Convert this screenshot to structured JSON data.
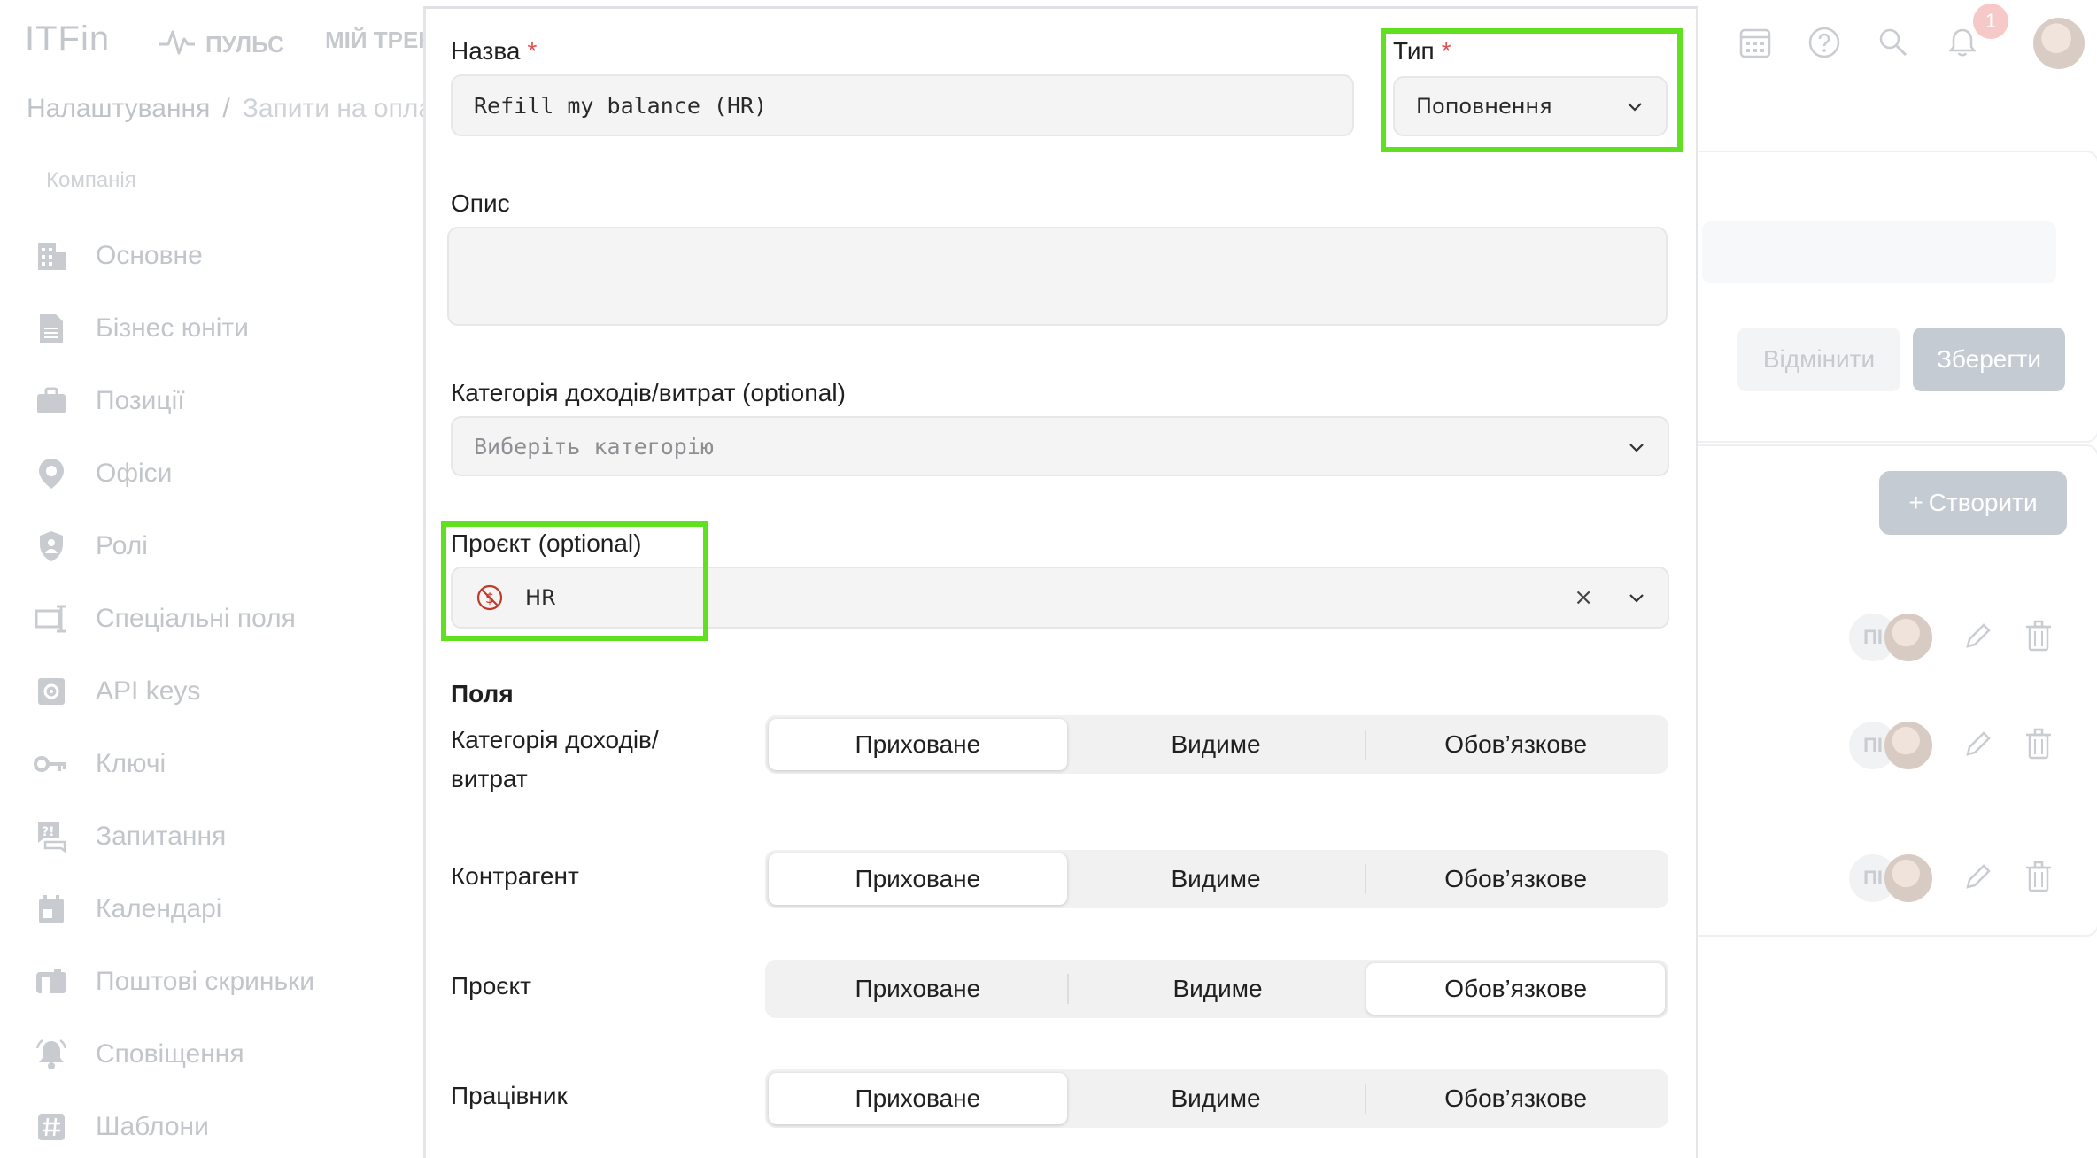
{
  "app": {
    "logo": "ITFin",
    "nav": [
      {
        "label": "ПУЛЬС",
        "icon": "pulse-icon"
      },
      {
        "label": "МІЙ ТРЕКЕ"
      }
    ],
    "notifications_count": "1",
    "breadcrumb": [
      "Налаштування",
      "/",
      "Запити на опла"
    ]
  },
  "sidebar": {
    "section": "Компанія",
    "items": [
      {
        "label": "Основне",
        "icon": "building-icon"
      },
      {
        "label": "Бізнес юніти",
        "icon": "document-icon"
      },
      {
        "label": "Позиції",
        "icon": "briefcase-icon"
      },
      {
        "label": "Офіси",
        "icon": "location-pin-icon"
      },
      {
        "label": "Ролі",
        "icon": "shield-icon"
      },
      {
        "label": "Спеціальні поля",
        "icon": "custom-field-icon"
      },
      {
        "label": "API keys",
        "icon": "gear-box-icon"
      },
      {
        "label": "Ключі",
        "icon": "key-icon"
      },
      {
        "label": "Запитання",
        "icon": "question-chat-icon"
      },
      {
        "label": "Календарі",
        "icon": "calendar-icon"
      },
      {
        "label": "Поштові скриньки",
        "icon": "mailbox-icon"
      },
      {
        "label": "Сповіщення",
        "icon": "bell-icon"
      },
      {
        "label": "Шаблони",
        "icon": "hash-icon"
      }
    ]
  },
  "right_panel": {
    "cancel_label": "Відмінити",
    "save_label": "Зберегти",
    "create_label": "Створити",
    "rows": [
      {
        "initials": "ПІ"
      },
      {
        "initials": "ПІ"
      },
      {
        "initials": "ПІ"
      }
    ]
  },
  "form": {
    "name_label": "Назва",
    "name_value": "Refill my balance (HR)",
    "type_label": "Тип",
    "type_value": "Поповнення",
    "required_mark": "*",
    "description_label": "Опис",
    "description_value": "",
    "category_label": "Категорія доходів/витрат (optional)",
    "category_placeholder": "Виберіть категорію",
    "project_label": "Проєкт (optional)",
    "project_value": "HR",
    "clear_symbol": "×",
    "fields_title": "Поля",
    "options": [
      "Приховане",
      "Видиме",
      "Обов’язкове"
    ],
    "fields": [
      {
        "label": "Категорія доходів/ витрат",
        "selected": "Приховане"
      },
      {
        "label": "Контрагент",
        "selected": "Приховане"
      },
      {
        "label": "Проєкт",
        "selected": "Обов’язкове"
      },
      {
        "label": "Працівник",
        "selected": "Приховане"
      }
    ]
  },
  "colors": {
    "highlight": "#5fe11f",
    "required": "#e05050"
  }
}
